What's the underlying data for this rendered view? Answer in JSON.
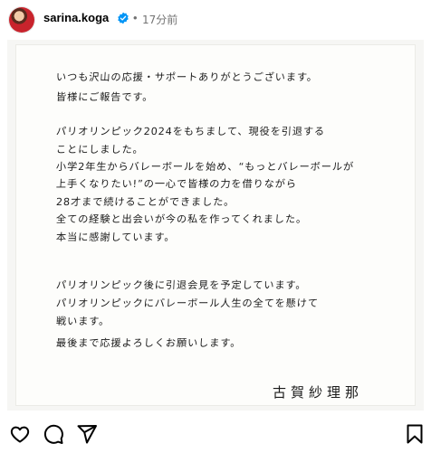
{
  "header": {
    "username": "sarina.koga",
    "separator": "•",
    "time_ago": "17分前"
  },
  "colors": {
    "verified_badge": "#0095f6",
    "secondary_text": "#737373",
    "paper": "#fdfdfb"
  },
  "post": {
    "lines": [
      "いつも沢山の応援・サポートありがとうございます。",
      "皆様にご報告です。",
      "パリオリンピック2024をもちまして、現役を引退する",
      "ことにしました。",
      "小学2年生からバレーボールを始め、“もっとバレーボールが",
      "上手くなりたい!”の一心で皆様の力を借りながら",
      "28才まで続けることができました。",
      "全ての経験と出会いが今の私を作ってくれました。",
      "本当に感謝しています。",
      "パリオリンピック後に引退会見を予定しています。",
      "パリオリンピックにバレーボール人生の全てを懸けて",
      "戦います。",
      "最後まで応援よろしくお願いします。"
    ],
    "signature": "古賀紗理那"
  },
  "actions": {
    "icons": [
      "heart-icon",
      "comment-icon",
      "share-icon",
      "bookmark-icon"
    ]
  }
}
